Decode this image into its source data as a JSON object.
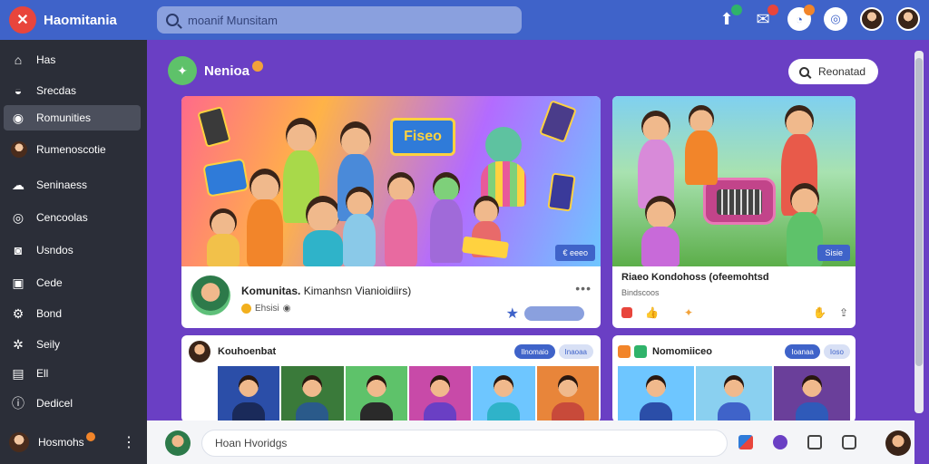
{
  "app": {
    "title": "Haomitania"
  },
  "search": {
    "placeholder": "moanif Munsitam"
  },
  "sidebar": {
    "items": [
      {
        "label": "Has",
        "icon": "home-icon"
      },
      {
        "label": "Srecdas",
        "icon": "compass-icon"
      },
      {
        "label": "Romunities",
        "icon": "communities-icon"
      },
      {
        "label": "Rumenoscotie",
        "icon": "avatar-icon"
      },
      {
        "label": "Seninaess",
        "icon": "cloud-icon"
      },
      {
        "label": "Cencoolas",
        "icon": "circle-icon"
      },
      {
        "label": "Usndos",
        "icon": "window-icon"
      },
      {
        "label": "Cede",
        "icon": "square-icon"
      },
      {
        "label": "Bond",
        "icon": "gear-icon"
      },
      {
        "label": "Seily",
        "icon": "settings-icon"
      },
      {
        "label": "Ell",
        "icon": "grid-icon"
      },
      {
        "label": "Dedicel",
        "icon": "info-icon"
      }
    ],
    "profile": {
      "name": "Hosmohs"
    }
  },
  "main": {
    "section_title": "Nenioa",
    "recent_button": "Reonatad",
    "card1": {
      "sign": "Fiseo",
      "tag": "€ eeeo",
      "title_bold": "Komunitas.",
      "title_rest": "Kimanhsn Vianioidiirs)",
      "meta": "Ehsisi"
    },
    "card2": {
      "tag": "Sisie",
      "title": "Riaeo Kondohoss (ofeemohtsd",
      "subtitle": "Bindscoos"
    },
    "card3": {
      "title": "Kouhoenbat",
      "chip1": "Ilnomaio",
      "chip2": "Inaoaa"
    },
    "card4": {
      "title": "Nomomiiceo",
      "chip1": "Ioanaa",
      "chip2": "Ioso"
    }
  },
  "composer": {
    "placeholder": "Hoan Hvoridgs"
  },
  "colors": {
    "topbar": "#3f63c9",
    "sidebar": "#2b2e38",
    "main_bg": "#6a3fc4",
    "accent": "#e8453c"
  }
}
